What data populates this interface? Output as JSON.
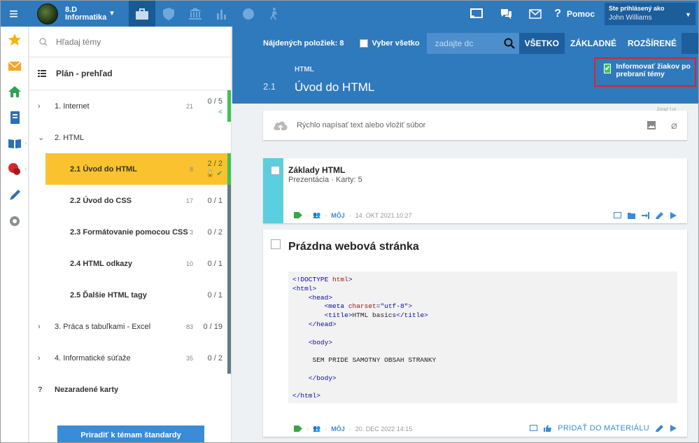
{
  "topbar": {
    "class_name": "8.D Informatika",
    "help_label": "Pomoc",
    "user_label": "Ste prihlásený ako",
    "user_name": "John Williams"
  },
  "sidebar": {
    "search_placeholder": "Hľadaj témy",
    "plan_label": "Plán - prehľad",
    "items": [
      {
        "label": "1. Internet",
        "count": "21",
        "progress": "0 / 5"
      },
      {
        "label": "2. HTML"
      },
      {
        "label": "2.1 Úvod do HTML",
        "count": "8",
        "progress": "2 / 2"
      },
      {
        "label": "2.2 Úvod do CSS",
        "count": "17",
        "progress": "0 / 1"
      },
      {
        "label": "2.3 Formátovanie pomocou CSS",
        "count": "3",
        "progress": "0 / 2"
      },
      {
        "label": "2.4 HTML odkazy",
        "count": "10",
        "progress": "0 / 1"
      },
      {
        "label": "2.5 Ďalšie HTML tagy",
        "progress": "0 / 1"
      },
      {
        "label": "3. Práca s tabuľkami - Excel",
        "count": "83",
        "progress": "0 / 19"
      },
      {
        "label": "4. Informatické súťaže",
        "count": "35",
        "progress": "0 / 2"
      },
      {
        "label": "Nezaradené karty"
      }
    ],
    "assign_button": "Priradiť k témam štandardy"
  },
  "header": {
    "found_label": "Nájdených položiek: 8",
    "select_all": "Vyber všetko",
    "search_placeholder": "zadajte dc",
    "filters": [
      "VŠETKO",
      "ZÁKLADNÉ",
      "ROZŠÍRENÉ"
    ],
    "topic_sub": "HTML",
    "topic_num": "2.1",
    "topic_title": "Úvod do HTML",
    "notify_label": "Informovať žiakov po prebraní témy"
  },
  "quick_post": {
    "placeholder": "Rýchlo napísať text alebo vložiť súbor",
    "tiny_label": "Zoraď 'I ut"
  },
  "card1": {
    "title": "Základy HTML",
    "meta": "Prezentácia · Karty: 5",
    "owner": "MÔJ",
    "date": "14. OKT 2021 10:27"
  },
  "card2": {
    "title": "Prázdna webová stránka",
    "owner": "MÔJ",
    "date": "20. DEC 2022 14:15",
    "add_label": "PRIDAŤ DO MATERIÁLU"
  },
  "colors": {
    "accent": "#2f79bd",
    "active_topic": "#f9c22e",
    "green": "#3fc157",
    "stripe": "#5bcfe0",
    "alert": "#d9262b"
  }
}
